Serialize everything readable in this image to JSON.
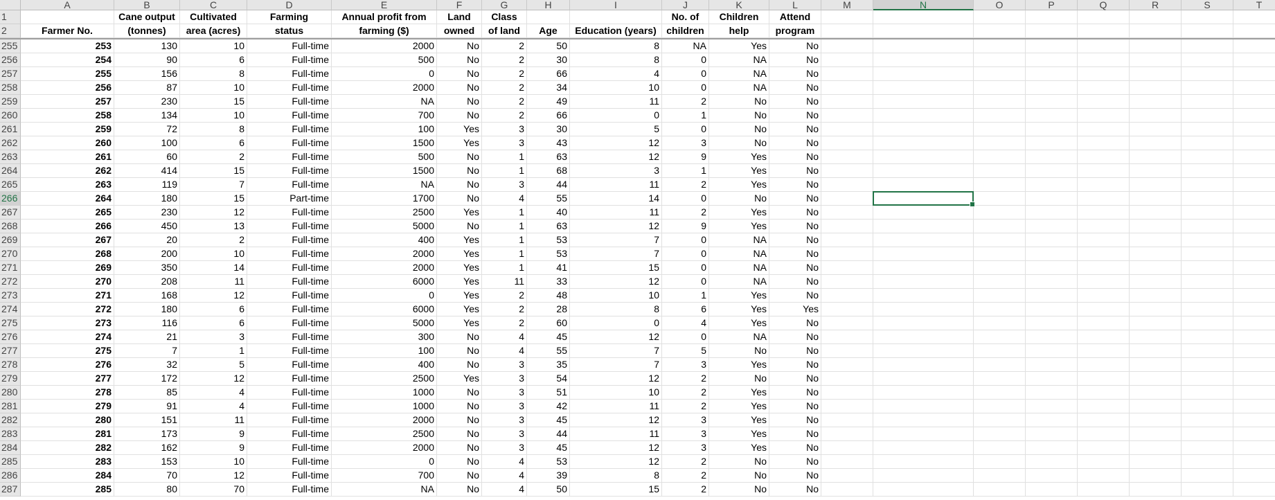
{
  "columns": [
    "A",
    "B",
    "C",
    "D",
    "E",
    "F",
    "G",
    "H",
    "I",
    "J",
    "K",
    "L",
    "M",
    "N",
    "O",
    "P",
    "Q",
    "R",
    "S",
    "T"
  ],
  "active_column": "N",
  "active_row": "266",
  "header_rows": [
    "1",
    "2"
  ],
  "headers": {
    "line1": [
      "",
      "Cane output",
      "Cultivated",
      "Farming",
      "Annual profit from",
      "Land",
      "Class",
      "",
      "",
      "No. of",
      "Children",
      "Attend"
    ],
    "line2": [
      "Farmer No.",
      "(tonnes)",
      "area (acres)",
      "status",
      "farming ($)",
      "owned",
      "of land",
      "Age",
      "Education (years)",
      "children",
      "help",
      "program"
    ]
  },
  "rows": [
    {
      "row": "255",
      "cells": [
        "253",
        "130",
        "10",
        "Full-time",
        "2000",
        "No",
        "2",
        "50",
        "8",
        "NA",
        "Yes",
        "No"
      ]
    },
    {
      "row": "256",
      "cells": [
        "254",
        "90",
        "6",
        "Full-time",
        "500",
        "No",
        "2",
        "30",
        "8",
        "0",
        "NA",
        "No"
      ]
    },
    {
      "row": "257",
      "cells": [
        "255",
        "156",
        "8",
        "Full-time",
        "0",
        "No",
        "2",
        "66",
        "4",
        "0",
        "NA",
        "No"
      ]
    },
    {
      "row": "258",
      "cells": [
        "256",
        "87",
        "10",
        "Full-time",
        "2000",
        "No",
        "2",
        "34",
        "10",
        "0",
        "NA",
        "No"
      ]
    },
    {
      "row": "259",
      "cells": [
        "257",
        "230",
        "15",
        "Full-time",
        "NA",
        "No",
        "2",
        "49",
        "11",
        "2",
        "No",
        "No"
      ]
    },
    {
      "row": "260",
      "cells": [
        "258",
        "134",
        "10",
        "Full-time",
        "700",
        "No",
        "2",
        "66",
        "0",
        "1",
        "No",
        "No"
      ]
    },
    {
      "row": "261",
      "cells": [
        "259",
        "72",
        "8",
        "Full-time",
        "100",
        "Yes",
        "3",
        "30",
        "5",
        "0",
        "No",
        "No"
      ]
    },
    {
      "row": "262",
      "cells": [
        "260",
        "100",
        "6",
        "Full-time",
        "1500",
        "Yes",
        "3",
        "43",
        "12",
        "3",
        "No",
        "No"
      ]
    },
    {
      "row": "263",
      "cells": [
        "261",
        "60",
        "2",
        "Full-time",
        "500",
        "No",
        "1",
        "63",
        "12",
        "9",
        "Yes",
        "No"
      ]
    },
    {
      "row": "264",
      "cells": [
        "262",
        "414",
        "15",
        "Full-time",
        "1500",
        "No",
        "1",
        "68",
        "3",
        "1",
        "Yes",
        "No"
      ]
    },
    {
      "row": "265",
      "cells": [
        "263",
        "119",
        "7",
        "Full-time",
        "NA",
        "No",
        "3",
        "44",
        "11",
        "2",
        "Yes",
        "No"
      ]
    },
    {
      "row": "266",
      "cells": [
        "264",
        "180",
        "15",
        "Part-time",
        "1700",
        "No",
        "4",
        "55",
        "14",
        "0",
        "No",
        "No"
      ]
    },
    {
      "row": "267",
      "cells": [
        "265",
        "230",
        "12",
        "Full-time",
        "2500",
        "Yes",
        "1",
        "40",
        "11",
        "2",
        "Yes",
        "No"
      ]
    },
    {
      "row": "268",
      "cells": [
        "266",
        "450",
        "13",
        "Full-time",
        "5000",
        "No",
        "1",
        "63",
        "12",
        "9",
        "Yes",
        "No"
      ]
    },
    {
      "row": "269",
      "cells": [
        "267",
        "20",
        "2",
        "Full-time",
        "400",
        "Yes",
        "1",
        "53",
        "7",
        "0",
        "NA",
        "No"
      ]
    },
    {
      "row": "270",
      "cells": [
        "268",
        "200",
        "10",
        "Full-time",
        "2000",
        "Yes",
        "1",
        "53",
        "7",
        "0",
        "NA",
        "No"
      ]
    },
    {
      "row": "271",
      "cells": [
        "269",
        "350",
        "14",
        "Full-time",
        "2000",
        "Yes",
        "1",
        "41",
        "15",
        "0",
        "NA",
        "No"
      ]
    },
    {
      "row": "272",
      "cells": [
        "270",
        "208",
        "11",
        "Full-time",
        "6000",
        "Yes",
        "11",
        "33",
        "12",
        "0",
        "NA",
        "No"
      ]
    },
    {
      "row": "273",
      "cells": [
        "271",
        "168",
        "12",
        "Full-time",
        "0",
        "Yes",
        "2",
        "48",
        "10",
        "1",
        "Yes",
        "No"
      ]
    },
    {
      "row": "274",
      "cells": [
        "272",
        "180",
        "6",
        "Full-time",
        "6000",
        "Yes",
        "2",
        "28",
        "8",
        "6",
        "Yes",
        "Yes"
      ]
    },
    {
      "row": "275",
      "cells": [
        "273",
        "116",
        "6",
        "Full-time",
        "5000",
        "Yes",
        "2",
        "60",
        "0",
        "4",
        "Yes",
        "No"
      ]
    },
    {
      "row": "276",
      "cells": [
        "274",
        "21",
        "3",
        "Full-time",
        "300",
        "No",
        "4",
        "45",
        "12",
        "0",
        "NA",
        "No"
      ]
    },
    {
      "row": "277",
      "cells": [
        "275",
        "7",
        "1",
        "Full-time",
        "100",
        "No",
        "4",
        "55",
        "7",
        "5",
        "No",
        "No"
      ]
    },
    {
      "row": "278",
      "cells": [
        "276",
        "32",
        "5",
        "Full-time",
        "400",
        "No",
        "3",
        "35",
        "7",
        "3",
        "Yes",
        "No"
      ]
    },
    {
      "row": "279",
      "cells": [
        "277",
        "172",
        "12",
        "Full-time",
        "2500",
        "Yes",
        "3",
        "54",
        "12",
        "2",
        "No",
        "No"
      ]
    },
    {
      "row": "280",
      "cells": [
        "278",
        "85",
        "4",
        "Full-time",
        "1000",
        "No",
        "3",
        "51",
        "10",
        "2",
        "Yes",
        "No"
      ]
    },
    {
      "row": "281",
      "cells": [
        "279",
        "91",
        "4",
        "Full-time",
        "1000",
        "No",
        "3",
        "42",
        "11",
        "2",
        "Yes",
        "No"
      ]
    },
    {
      "row": "282",
      "cells": [
        "280",
        "151",
        "11",
        "Full-time",
        "2000",
        "No",
        "3",
        "45",
        "12",
        "3",
        "Yes",
        "No"
      ]
    },
    {
      "row": "283",
      "cells": [
        "281",
        "173",
        "9",
        "Full-time",
        "2500",
        "No",
        "3",
        "44",
        "11",
        "3",
        "Yes",
        "No"
      ]
    },
    {
      "row": "284",
      "cells": [
        "282",
        "162",
        "9",
        "Full-time",
        "2000",
        "No",
        "3",
        "45",
        "12",
        "3",
        "Yes",
        "No"
      ]
    },
    {
      "row": "285",
      "cells": [
        "283",
        "153",
        "10",
        "Full-time",
        "0",
        "No",
        "4",
        "53",
        "12",
        "2",
        "No",
        "No"
      ]
    },
    {
      "row": "286",
      "cells": [
        "284",
        "70",
        "12",
        "Full-time",
        "700",
        "No",
        "4",
        "39",
        "8",
        "2",
        "No",
        "No"
      ]
    },
    {
      "row": "287",
      "cells": [
        "285",
        "80",
        "70",
        "Full-time",
        "NA",
        "No",
        "4",
        "50",
        "15",
        "2",
        "No",
        "No"
      ]
    }
  ],
  "colors": {
    "accent": "#217346",
    "header_bg": "#e6e6e6",
    "grid": "#e0e0e0"
  }
}
